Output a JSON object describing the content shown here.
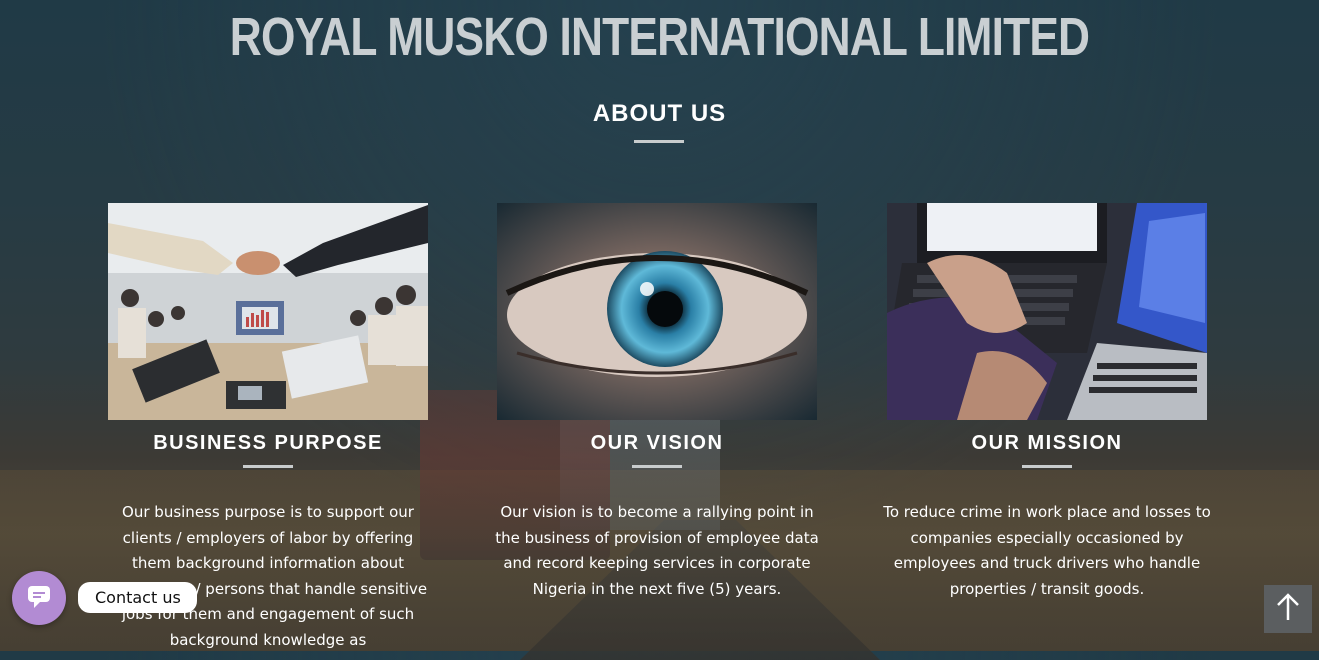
{
  "header": {
    "site_title": "ROYAL MUSKO INTERNATIONAL LIMITED",
    "section_title": "ABOUT US"
  },
  "cards": [
    {
      "title": "BUSINESS PURPOSE",
      "image": "business-meeting-handshake-photo",
      "text": "Our business purpose is to support our clients / employers of labor by offering them background information about employees / persons that handle sensitive jobs for them and engagement of such background knowledge as"
    },
    {
      "title": "OUR VISION",
      "image": "eye-closeup-photo",
      "text": "Our vision is to become a rallying point in the business of provision of employee data and record keeping services in corporate Nigeria in the next five (5) years."
    },
    {
      "title": "OUR MISSION",
      "image": "laptops-typing-photo",
      "text": "To reduce crime in work place and losses to companies especially occasioned by employees and truck drivers who handle properties / transit goods."
    }
  ],
  "widgets": {
    "contact_label": "Contact us",
    "contact_icon": "chat-bubble-icon",
    "scroll_top_icon": "arrow-up-icon"
  },
  "colors": {
    "contact_accent": "#b28bd3",
    "rule": "#c8cccd",
    "scroll_top_bg": "#5b5e60"
  }
}
